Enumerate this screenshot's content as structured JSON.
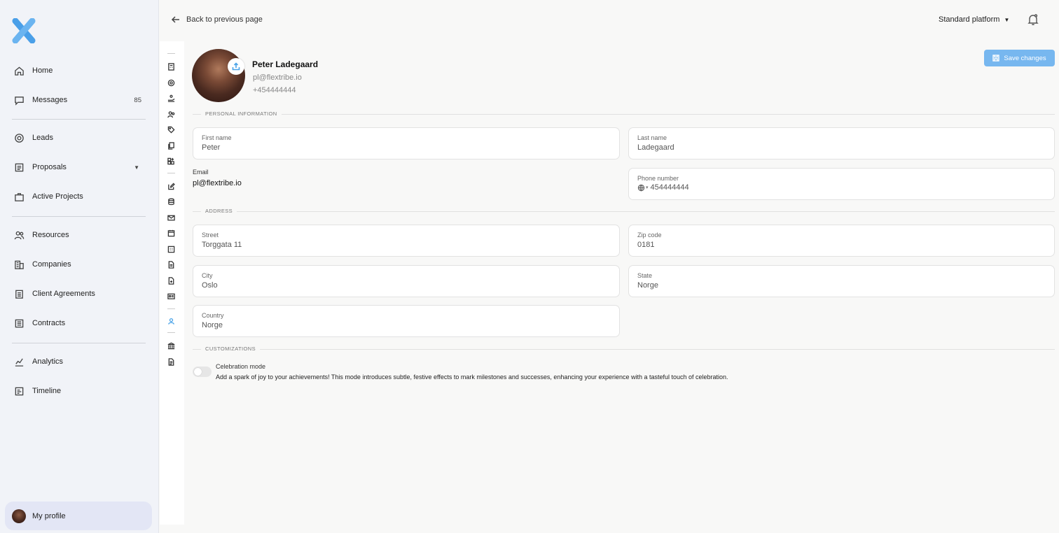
{
  "sidebar": {
    "logo_icon": "flextribe-x-logo",
    "items": [
      {
        "label": "Home",
        "icon": "home-icon"
      },
      {
        "label": "Messages",
        "icon": "message-icon",
        "badge": "85"
      },
      {
        "label": "Leads",
        "icon": "at-icon"
      },
      {
        "label": "Proposals",
        "icon": "document-icon"
      },
      {
        "label": "Active Projects",
        "icon": "briefcase-icon"
      },
      {
        "label": "Resources",
        "icon": "users-icon"
      },
      {
        "label": "Companies",
        "icon": "building-icon"
      },
      {
        "label": "Client Agreements",
        "icon": "clipboard-icon"
      },
      {
        "label": "Contracts",
        "icon": "contract-icon"
      },
      {
        "label": "Analytics",
        "icon": "chart-icon"
      },
      {
        "label": "Timeline",
        "icon": "timeline-icon"
      }
    ],
    "profile_label": "My profile"
  },
  "topbar": {
    "back_label": "Back to previous page",
    "platform_label": "Standard platform"
  },
  "profile": {
    "name": "Peter Ladegaard",
    "email": "pl@flextribe.io",
    "phone": "+454444444",
    "save_label": "Save changes"
  },
  "sections": {
    "personal": "PERSONAL INFORMATION",
    "address": "ADDRESS",
    "customizations": "CUSTOMIZATIONS"
  },
  "fields": {
    "first_name": {
      "label": "First name",
      "value": "Peter"
    },
    "last_name": {
      "label": "Last name",
      "value": "Ladegaard"
    },
    "email": {
      "label": "Email",
      "value": "pl@flextribe.io"
    },
    "phone": {
      "label": "Phone number",
      "value": "454444444"
    },
    "street": {
      "label": "Street",
      "value": "Torggata 11"
    },
    "zip": {
      "label": "Zip code",
      "value": "0181"
    },
    "city": {
      "label": "City",
      "value": "Oslo"
    },
    "state": {
      "label": "State",
      "value": "Norge"
    },
    "country": {
      "label": "Country",
      "value": "Norge"
    }
  },
  "customizations": {
    "celebration_title": "Celebration mode",
    "celebration_desc": "Add a spark of joy to your achievements! This mode introduces subtle, festive effects to mark milestones and successes, enhancing your experience with a tasteful touch of celebration.",
    "celebration_enabled": false
  },
  "colors": {
    "accent": "#77b7ef",
    "logo": "#4a9fe8",
    "sidebar_bg": "#f1f3f8",
    "profile_highlight": "#e3e6f5"
  }
}
